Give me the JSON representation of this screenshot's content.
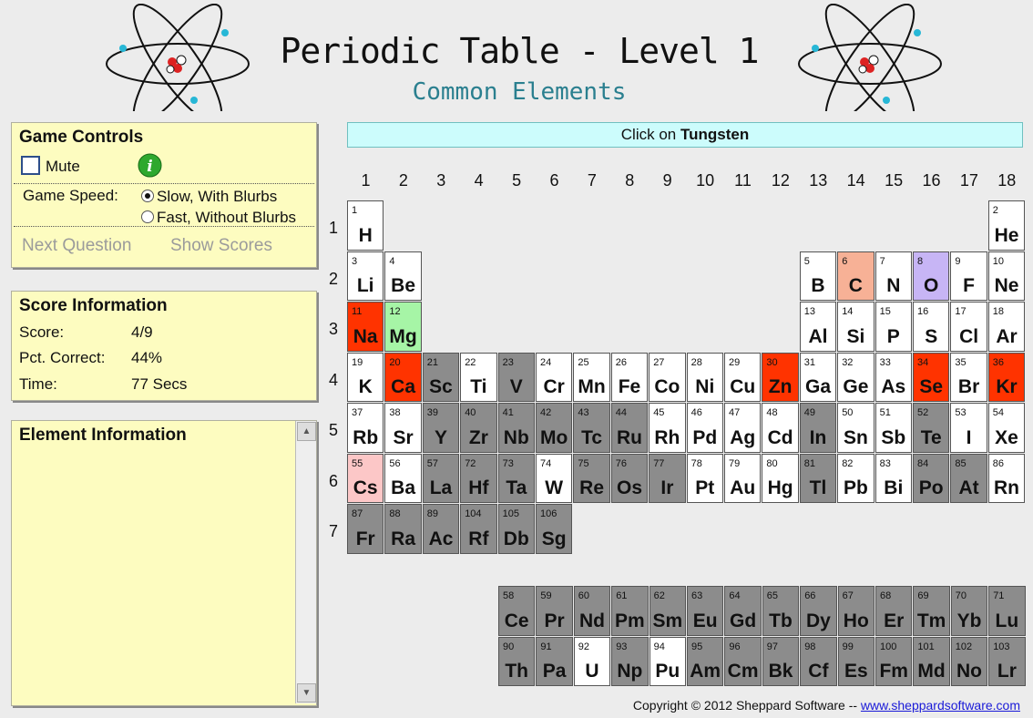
{
  "header": {
    "title": "Periodic Table - Level 1",
    "subtitle": "Common Elements"
  },
  "game_controls": {
    "heading": "Game Controls",
    "mute_label": "Mute",
    "mute_checked": false,
    "info_icon": "i",
    "speed_label": "Game Speed:",
    "speed_options": [
      "Slow, With Blurbs",
      "Fast, Without Blurbs"
    ],
    "speed_selected": "Slow, With Blurbs",
    "next_question": "Next Question",
    "show_scores": "Show Scores"
  },
  "score": {
    "heading": "Score Information",
    "score_label": "Score:",
    "score_value": "4/9",
    "pct_label": "Pct. Correct:",
    "pct_value": "44%",
    "time_label": "Time:",
    "time_value": "77 Secs"
  },
  "element_info": {
    "heading": "Element Information"
  },
  "prompt": {
    "prefix": "Click on ",
    "target": "Tungsten"
  },
  "group_labels": [
    "1",
    "2",
    "3",
    "4",
    "5",
    "6",
    "7",
    "8",
    "9",
    "10",
    "11",
    "12",
    "13",
    "14",
    "15",
    "16",
    "17",
    "18"
  ],
  "period_labels": [
    "1",
    "2",
    "3",
    "4",
    "5",
    "6",
    "7"
  ],
  "colors": {
    "white": "#ffffff",
    "gray": "#8c8c8c",
    "wrong": "#ff3300",
    "salmon": "#f7b196",
    "purple": "#c7b5f5",
    "green": "#a6f5a6",
    "pink": "#fcc7c7"
  },
  "elements": [
    {
      "n": 1,
      "s": "H",
      "c": "white"
    },
    {
      "n": 2,
      "s": "He",
      "c": "white"
    },
    {
      "n": 3,
      "s": "Li",
      "c": "white"
    },
    {
      "n": 4,
      "s": "Be",
      "c": "white"
    },
    {
      "n": 5,
      "s": "B",
      "c": "white"
    },
    {
      "n": 6,
      "s": "C",
      "c": "salmon"
    },
    {
      "n": 7,
      "s": "N",
      "c": "white"
    },
    {
      "n": 8,
      "s": "O",
      "c": "purple"
    },
    {
      "n": 9,
      "s": "F",
      "c": "white"
    },
    {
      "n": 10,
      "s": "Ne",
      "c": "white"
    },
    {
      "n": 11,
      "s": "Na",
      "c": "wrong"
    },
    {
      "n": 12,
      "s": "Mg",
      "c": "green"
    },
    {
      "n": 13,
      "s": "Al",
      "c": "white"
    },
    {
      "n": 14,
      "s": "Si",
      "c": "white"
    },
    {
      "n": 15,
      "s": "P",
      "c": "white"
    },
    {
      "n": 16,
      "s": "S",
      "c": "white"
    },
    {
      "n": 17,
      "s": "Cl",
      "c": "white"
    },
    {
      "n": 18,
      "s": "Ar",
      "c": "white"
    },
    {
      "n": 19,
      "s": "K",
      "c": "white"
    },
    {
      "n": 20,
      "s": "Ca",
      "c": "wrong"
    },
    {
      "n": 21,
      "s": "Sc",
      "c": "gray"
    },
    {
      "n": 22,
      "s": "Ti",
      "c": "white"
    },
    {
      "n": 23,
      "s": "V",
      "c": "gray"
    },
    {
      "n": 24,
      "s": "Cr",
      "c": "white"
    },
    {
      "n": 25,
      "s": "Mn",
      "c": "white"
    },
    {
      "n": 26,
      "s": "Fe",
      "c": "white"
    },
    {
      "n": 27,
      "s": "Co",
      "c": "white"
    },
    {
      "n": 28,
      "s": "Ni",
      "c": "white"
    },
    {
      "n": 29,
      "s": "Cu",
      "c": "white"
    },
    {
      "n": 30,
      "s": "Zn",
      "c": "wrong"
    },
    {
      "n": 31,
      "s": "Ga",
      "c": "white"
    },
    {
      "n": 32,
      "s": "Ge",
      "c": "white"
    },
    {
      "n": 33,
      "s": "As",
      "c": "white"
    },
    {
      "n": 34,
      "s": "Se",
      "c": "wrong"
    },
    {
      "n": 35,
      "s": "Br",
      "c": "white"
    },
    {
      "n": 36,
      "s": "Kr",
      "c": "wrong"
    },
    {
      "n": 37,
      "s": "Rb",
      "c": "white"
    },
    {
      "n": 38,
      "s": "Sr",
      "c": "white"
    },
    {
      "n": 39,
      "s": "Y",
      "c": "gray"
    },
    {
      "n": 40,
      "s": "Zr",
      "c": "gray"
    },
    {
      "n": 41,
      "s": "Nb",
      "c": "gray"
    },
    {
      "n": 42,
      "s": "Mo",
      "c": "gray"
    },
    {
      "n": 43,
      "s": "Tc",
      "c": "gray"
    },
    {
      "n": 44,
      "s": "Ru",
      "c": "gray"
    },
    {
      "n": 45,
      "s": "Rh",
      "c": "white"
    },
    {
      "n": 46,
      "s": "Pd",
      "c": "white"
    },
    {
      "n": 47,
      "s": "Ag",
      "c": "white"
    },
    {
      "n": 48,
      "s": "Cd",
      "c": "white"
    },
    {
      "n": 49,
      "s": "In",
      "c": "gray"
    },
    {
      "n": 50,
      "s": "Sn",
      "c": "white"
    },
    {
      "n": 51,
      "s": "Sb",
      "c": "white"
    },
    {
      "n": 52,
      "s": "Te",
      "c": "gray"
    },
    {
      "n": 53,
      "s": "I",
      "c": "white"
    },
    {
      "n": 54,
      "s": "Xe",
      "c": "white"
    },
    {
      "n": 55,
      "s": "Cs",
      "c": "pink"
    },
    {
      "n": 56,
      "s": "Ba",
      "c": "white"
    },
    {
      "n": 57,
      "s": "La",
      "c": "gray"
    },
    {
      "n": 72,
      "s": "Hf",
      "c": "gray"
    },
    {
      "n": 73,
      "s": "Ta",
      "c": "gray"
    },
    {
      "n": 74,
      "s": "W",
      "c": "white"
    },
    {
      "n": 75,
      "s": "Re",
      "c": "gray"
    },
    {
      "n": 76,
      "s": "Os",
      "c": "gray"
    },
    {
      "n": 77,
      "s": "Ir",
      "c": "gray"
    },
    {
      "n": 78,
      "s": "Pt",
      "c": "white"
    },
    {
      "n": 79,
      "s": "Au",
      "c": "white"
    },
    {
      "n": 80,
      "s": "Hg",
      "c": "white"
    },
    {
      "n": 81,
      "s": "Tl",
      "c": "gray"
    },
    {
      "n": 82,
      "s": "Pb",
      "c": "white"
    },
    {
      "n": 83,
      "s": "Bi",
      "c": "white"
    },
    {
      "n": 84,
      "s": "Po",
      "c": "gray"
    },
    {
      "n": 85,
      "s": "At",
      "c": "gray"
    },
    {
      "n": 86,
      "s": "Rn",
      "c": "white"
    },
    {
      "n": 87,
      "s": "Fr",
      "c": "gray"
    },
    {
      "n": 88,
      "s": "Ra",
      "c": "gray"
    },
    {
      "n": 89,
      "s": "Ac",
      "c": "gray"
    },
    {
      "n": 104,
      "s": "Rf",
      "c": "gray"
    },
    {
      "n": 105,
      "s": "Db",
      "c": "gray"
    },
    {
      "n": 106,
      "s": "Sg",
      "c": "gray"
    },
    {
      "n": 58,
      "s": "Ce",
      "c": "gray"
    },
    {
      "n": 59,
      "s": "Pr",
      "c": "gray"
    },
    {
      "n": 60,
      "s": "Nd",
      "c": "gray"
    },
    {
      "n": 61,
      "s": "Pm",
      "c": "gray"
    },
    {
      "n": 62,
      "s": "Sm",
      "c": "gray"
    },
    {
      "n": 63,
      "s": "Eu",
      "c": "gray"
    },
    {
      "n": 64,
      "s": "Gd",
      "c": "gray"
    },
    {
      "n": 65,
      "s": "Tb",
      "c": "gray"
    },
    {
      "n": 66,
      "s": "Dy",
      "c": "gray"
    },
    {
      "n": 67,
      "s": "Ho",
      "c": "gray"
    },
    {
      "n": 68,
      "s": "Er",
      "c": "gray"
    },
    {
      "n": 69,
      "s": "Tm",
      "c": "gray"
    },
    {
      "n": 70,
      "s": "Yb",
      "c": "gray"
    },
    {
      "n": 71,
      "s": "Lu",
      "c": "gray"
    },
    {
      "n": 90,
      "s": "Th",
      "c": "gray"
    },
    {
      "n": 91,
      "s": "Pa",
      "c": "gray"
    },
    {
      "n": 92,
      "s": "U",
      "c": "white"
    },
    {
      "n": 93,
      "s": "Np",
      "c": "gray"
    },
    {
      "n": 94,
      "s": "Pu",
      "c": "white"
    },
    {
      "n": 95,
      "s": "Am",
      "c": "gray"
    },
    {
      "n": 96,
      "s": "Cm",
      "c": "gray"
    },
    {
      "n": 97,
      "s": "Bk",
      "c": "gray"
    },
    {
      "n": 98,
      "s": "Cf",
      "c": "gray"
    },
    {
      "n": 99,
      "s": "Es",
      "c": "gray"
    },
    {
      "n": 100,
      "s": "Fm",
      "c": "gray"
    },
    {
      "n": 101,
      "s": "Md",
      "c": "gray"
    },
    {
      "n": 102,
      "s": "No",
      "c": "gray"
    },
    {
      "n": 103,
      "s": "Lr",
      "c": "gray"
    }
  ],
  "footer": {
    "copyright": "Copyright © 2012 Sheppard Software -- ",
    "link_text": "www.sheppardsoftware.com"
  }
}
